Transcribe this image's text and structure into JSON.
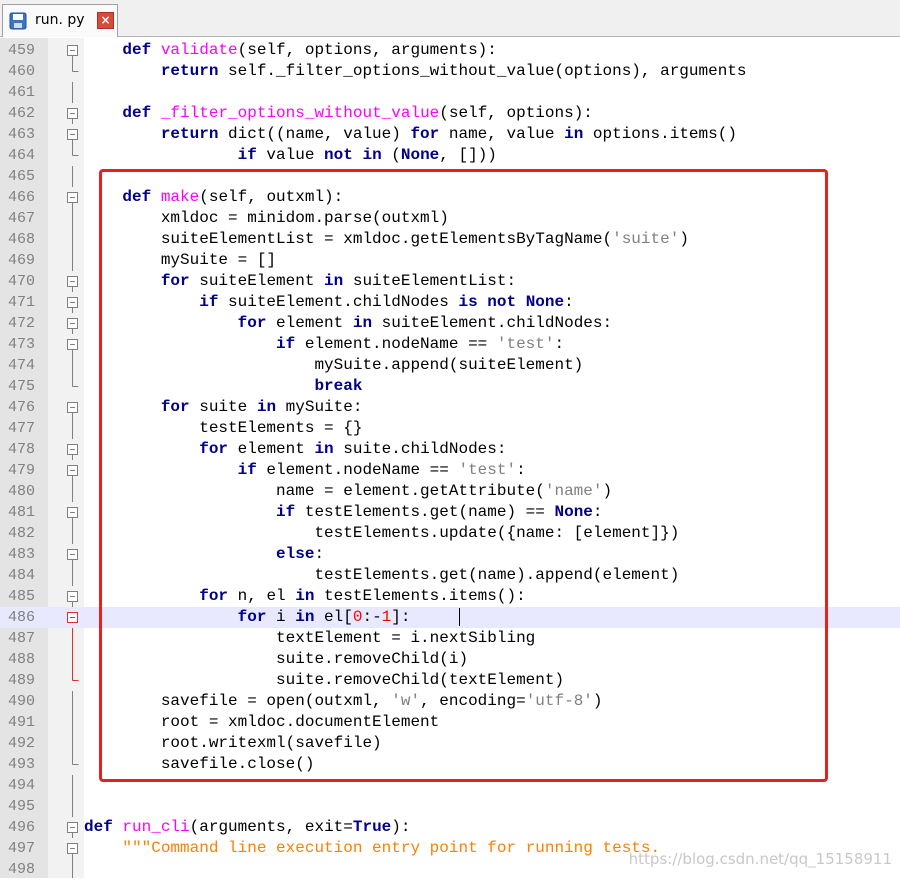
{
  "tab": {
    "filename": "run. py"
  },
  "watermark": "https://blog.csdn.net/qq_15158911",
  "lines": [
    {
      "n": "459",
      "fold": "box",
      "segs": [
        [
          "    ",
          ""
        ],
        [
          "def",
          "kw"
        ],
        [
          " ",
          ""
        ],
        [
          "validate",
          "fn"
        ],
        [
          "(self, options, arguments):",
          ""
        ]
      ]
    },
    {
      "n": "460",
      "fold": "end",
      "segs": [
        [
          "        ",
          ""
        ],
        [
          "return",
          "kw"
        ],
        [
          " self._filter_options_without_value(options), arguments",
          ""
        ]
      ]
    },
    {
      "n": "461",
      "fold": "line",
      "segs": []
    },
    {
      "n": "462",
      "fold": "box",
      "segs": [
        [
          "    ",
          ""
        ],
        [
          "def",
          "kw"
        ],
        [
          " ",
          ""
        ],
        [
          "_filter_options_without_value",
          "fn"
        ],
        [
          "(self, options):",
          ""
        ]
      ]
    },
    {
      "n": "463",
      "fold": "box",
      "segs": [
        [
          "        ",
          ""
        ],
        [
          "return",
          "kw"
        ],
        [
          " dict((name, value) ",
          ""
        ],
        [
          "for",
          "kw"
        ],
        [
          " name, value ",
          ""
        ],
        [
          "in",
          "kw"
        ],
        [
          " options.items()",
          ""
        ]
      ]
    },
    {
      "n": "464",
      "fold": "end",
      "segs": [
        [
          "                ",
          ""
        ],
        [
          "if",
          "kw"
        ],
        [
          " value ",
          ""
        ],
        [
          "not",
          "kw"
        ],
        [
          " ",
          ""
        ],
        [
          "in",
          "kw"
        ],
        [
          " (",
          ""
        ],
        [
          "None",
          "kw"
        ],
        [
          ", []))",
          ""
        ]
      ]
    },
    {
      "n": "465",
      "fold": "line",
      "segs": []
    },
    {
      "n": "466",
      "fold": "box",
      "segs": [
        [
          "    ",
          ""
        ],
        [
          "def",
          "kw"
        ],
        [
          " ",
          ""
        ],
        [
          "make",
          "fn"
        ],
        [
          "(self, outxml):",
          ""
        ]
      ]
    },
    {
      "n": "467",
      "fold": "line",
      "segs": [
        [
          "        xmldoc = minidom.parse(outxml)",
          ""
        ]
      ]
    },
    {
      "n": "468",
      "fold": "line",
      "segs": [
        [
          "        suiteElementList = xmldoc.getElementsByTagName(",
          ""
        ],
        [
          "'suite'",
          "str"
        ],
        [
          ")",
          ""
        ]
      ]
    },
    {
      "n": "469",
      "fold": "line",
      "segs": [
        [
          "        mySuite = []",
          ""
        ]
      ]
    },
    {
      "n": "470",
      "fold": "box",
      "segs": [
        [
          "        ",
          ""
        ],
        [
          "for",
          "kw"
        ],
        [
          " suiteElement ",
          ""
        ],
        [
          "in",
          "kw"
        ],
        [
          " suiteElementList:",
          ""
        ]
      ]
    },
    {
      "n": "471",
      "fold": "box",
      "segs": [
        [
          "            ",
          ""
        ],
        [
          "if",
          "kw"
        ],
        [
          " suiteElement.childNodes ",
          ""
        ],
        [
          "is",
          "kw"
        ],
        [
          " ",
          ""
        ],
        [
          "not",
          "kw"
        ],
        [
          " ",
          ""
        ],
        [
          "None",
          "kw"
        ],
        [
          ":",
          ""
        ]
      ]
    },
    {
      "n": "472",
      "fold": "box",
      "segs": [
        [
          "                ",
          ""
        ],
        [
          "for",
          "kw"
        ],
        [
          " element ",
          ""
        ],
        [
          "in",
          "kw"
        ],
        [
          " suiteElement.childNodes:",
          ""
        ]
      ]
    },
    {
      "n": "473",
      "fold": "box",
      "segs": [
        [
          "                    ",
          ""
        ],
        [
          "if",
          "kw"
        ],
        [
          " element.nodeName == ",
          ""
        ],
        [
          "'test'",
          "str"
        ],
        [
          ":",
          ""
        ]
      ]
    },
    {
      "n": "474",
      "fold": "line",
      "segs": [
        [
          "                        mySuite.append(suiteElement)",
          ""
        ]
      ]
    },
    {
      "n": "475",
      "fold": "end",
      "segs": [
        [
          "                        ",
          ""
        ],
        [
          "break",
          "kw"
        ]
      ]
    },
    {
      "n": "476",
      "fold": "box",
      "segs": [
        [
          "        ",
          ""
        ],
        [
          "for",
          "kw"
        ],
        [
          " suite ",
          ""
        ],
        [
          "in",
          "kw"
        ],
        [
          " mySuite:",
          ""
        ]
      ]
    },
    {
      "n": "477",
      "fold": "line",
      "segs": [
        [
          "            testElements = {}",
          ""
        ]
      ]
    },
    {
      "n": "478",
      "fold": "box",
      "segs": [
        [
          "            ",
          ""
        ],
        [
          "for",
          "kw"
        ],
        [
          " element ",
          ""
        ],
        [
          "in",
          "kw"
        ],
        [
          " suite.childNodes:",
          ""
        ]
      ]
    },
    {
      "n": "479",
      "fold": "box",
      "segs": [
        [
          "                ",
          ""
        ],
        [
          "if",
          "kw"
        ],
        [
          " element.nodeName == ",
          ""
        ],
        [
          "'test'",
          "str"
        ],
        [
          ":",
          ""
        ]
      ]
    },
    {
      "n": "480",
      "fold": "line",
      "segs": [
        [
          "                    name = element.getAttribute(",
          ""
        ],
        [
          "'name'",
          "str"
        ],
        [
          ")",
          ""
        ]
      ]
    },
    {
      "n": "481",
      "fold": "box",
      "segs": [
        [
          "                    ",
          ""
        ],
        [
          "if",
          "kw"
        ],
        [
          " testElements.get(name) == ",
          ""
        ],
        [
          "None",
          "kw"
        ],
        [
          ":",
          ""
        ]
      ]
    },
    {
      "n": "482",
      "fold": "line",
      "segs": [
        [
          "                        testElements.update({name: [element]})",
          ""
        ]
      ]
    },
    {
      "n": "483",
      "fold": "box",
      "segs": [
        [
          "                    ",
          ""
        ],
        [
          "else",
          "kw"
        ],
        [
          ":",
          ""
        ]
      ]
    },
    {
      "n": "484",
      "fold": "line",
      "segs": [
        [
          "                        testElements.get(name).append(element)",
          ""
        ]
      ]
    },
    {
      "n": "485",
      "fold": "box",
      "segs": [
        [
          "            ",
          ""
        ],
        [
          "for",
          "kw"
        ],
        [
          " n, el ",
          ""
        ],
        [
          "in",
          "kw"
        ],
        [
          " testElements.items():",
          ""
        ]
      ]
    },
    {
      "n": "486",
      "fold": "redbox",
      "current": true,
      "segs": [
        [
          "                ",
          ""
        ],
        [
          "for",
          "kw"
        ],
        [
          " i ",
          ""
        ],
        [
          "in",
          "kw"
        ],
        [
          " el[",
          ""
        ],
        [
          "0",
          "num"
        ],
        [
          ":-",
          ""
        ],
        [
          "1",
          "num"
        ],
        [
          "]:",
          ""
        ]
      ]
    },
    {
      "n": "487",
      "fold": "redline",
      "segs": [
        [
          "                    textElement = i.nextSibling",
          ""
        ]
      ]
    },
    {
      "n": "488",
      "fold": "redline",
      "segs": [
        [
          "                    suite.removeChild(i)",
          ""
        ]
      ]
    },
    {
      "n": "489",
      "fold": "redend",
      "segs": [
        [
          "                    suite.removeChild(textElement)",
          ""
        ]
      ]
    },
    {
      "n": "490",
      "fold": "line",
      "segs": [
        [
          "        savefile = open(outxml, ",
          ""
        ],
        [
          "'w'",
          "str"
        ],
        [
          ", encoding=",
          ""
        ],
        [
          "'utf-8'",
          "str"
        ],
        [
          ")",
          ""
        ]
      ]
    },
    {
      "n": "491",
      "fold": "line",
      "segs": [
        [
          "        root = xmldoc.documentElement",
          ""
        ]
      ]
    },
    {
      "n": "492",
      "fold": "line",
      "segs": [
        [
          "        root.writexml(savefile)",
          ""
        ]
      ]
    },
    {
      "n": "493",
      "fold": "end",
      "segs": [
        [
          "        savefile.close()",
          ""
        ]
      ]
    },
    {
      "n": "494",
      "fold": "line",
      "segs": []
    },
    {
      "n": "495",
      "fold": "line",
      "segs": []
    },
    {
      "n": "496",
      "fold": "box",
      "segs": [
        [
          "def",
          "kw"
        ],
        [
          " ",
          ""
        ],
        [
          "run_cli",
          "fn"
        ],
        [
          "(arguments, exit=",
          ""
        ],
        [
          "True",
          "kw"
        ],
        [
          "):",
          ""
        ]
      ]
    },
    {
      "n": "497",
      "fold": "box",
      "segs": [
        [
          "    ",
          ""
        ],
        [
          "\"\"\"Command line execution entry point for running tests.",
          "doc"
        ]
      ]
    },
    {
      "n": "498",
      "fold": "line",
      "segs": []
    }
  ],
  "colors": {
    "accent_red": "#e8221a",
    "keyword": "#00008b",
    "function": "#ff00ff",
    "string": "#808080"
  }
}
